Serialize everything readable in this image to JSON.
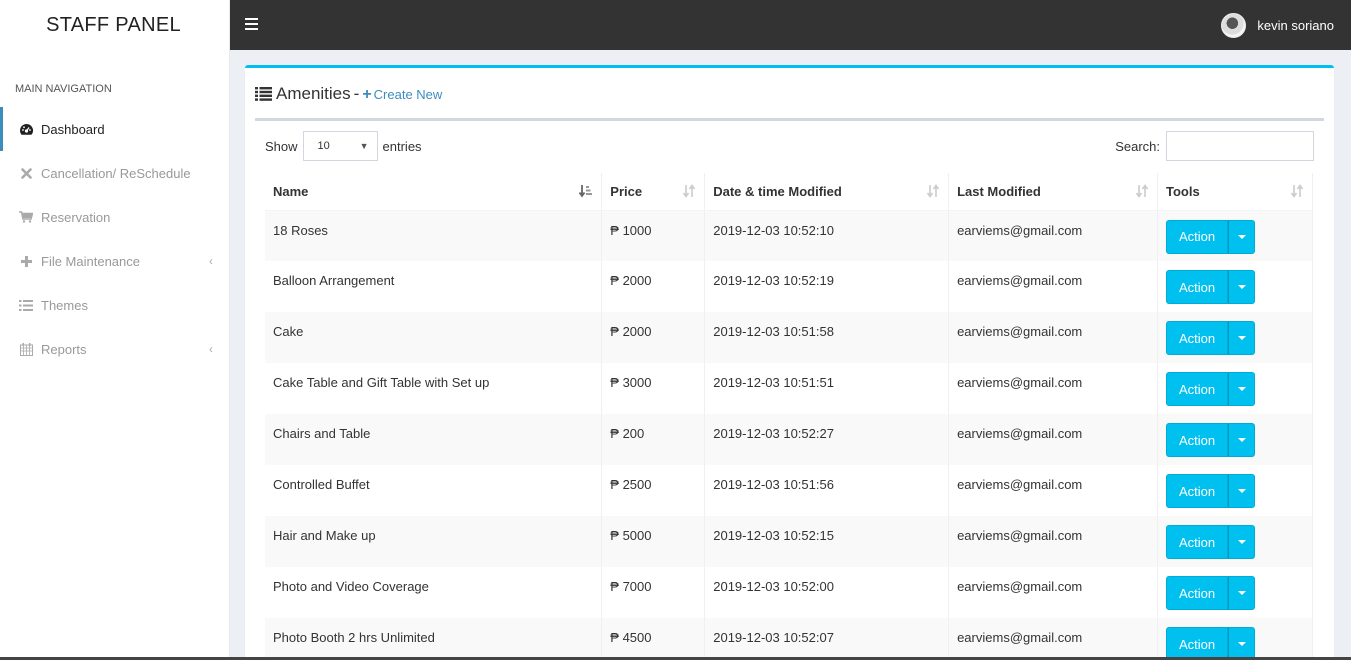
{
  "sidebar": {
    "brand": "STAFF PANEL",
    "nav_header": "MAIN NAVIGATION",
    "items": [
      {
        "label": "Dashboard",
        "icon": "dashboard-icon",
        "active": true,
        "has_submenu": false
      },
      {
        "label": "Cancellation/ ReSchedule",
        "icon": "close-icon",
        "active": false,
        "has_submenu": false
      },
      {
        "label": "Reservation",
        "icon": "cart-icon",
        "active": false,
        "has_submenu": false
      },
      {
        "label": "File Maintenance",
        "icon": "plus-icon",
        "active": false,
        "has_submenu": true
      },
      {
        "label": "Themes",
        "icon": "list-icon",
        "active": false,
        "has_submenu": false
      },
      {
        "label": "Reports",
        "icon": "calendar-icon",
        "active": false,
        "has_submenu": true
      }
    ]
  },
  "topbar": {
    "user_name": "kevin soriano"
  },
  "box": {
    "title": "Amenities",
    "separator": "-",
    "create_label": "Create New"
  },
  "controls": {
    "show_label": "Show",
    "entries_value": "10",
    "entries_label": "entries",
    "search_label": "Search:",
    "search_value": ""
  },
  "table": {
    "columns": [
      "Name",
      "Price",
      "Date & time Modified",
      "Last Modified",
      "Tools"
    ],
    "rows": [
      {
        "name": "18 Roses",
        "price": "₱ 1000",
        "date": "2019-12-03 10:52:10",
        "last": "earviems@gmail.com",
        "action": "Action"
      },
      {
        "name": "Balloon Arrangement",
        "price": "₱ 2000",
        "date": "2019-12-03 10:52:19",
        "last": "earviems@gmail.com",
        "action": "Action"
      },
      {
        "name": "Cake",
        "price": "₱ 2000",
        "date": "2019-12-03 10:51:58",
        "last": "earviems@gmail.com",
        "action": "Action"
      },
      {
        "name": "Cake Table and Gift Table with Set up",
        "price": "₱ 3000",
        "date": "2019-12-03 10:51:51",
        "last": "earviems@gmail.com",
        "action": "Action"
      },
      {
        "name": "Chairs and Table",
        "price": "₱ 200",
        "date": "2019-12-03 10:52:27",
        "last": "earviems@gmail.com",
        "action": "Action"
      },
      {
        "name": "Controlled Buffet",
        "price": "₱ 2500",
        "date": "2019-12-03 10:51:56",
        "last": "earviems@gmail.com",
        "action": "Action"
      },
      {
        "name": "Hair and Make up",
        "price": "₱ 5000",
        "date": "2019-12-03 10:52:15",
        "last": "earviems@gmail.com",
        "action": "Action"
      },
      {
        "name": "Photo and Video Coverage",
        "price": "₱ 7000",
        "date": "2019-12-03 10:52:00",
        "last": "earviems@gmail.com",
        "action": "Action"
      },
      {
        "name": "Photo Booth 2 hrs Unlimited",
        "price": "₱ 4500",
        "date": "2019-12-03 10:52:07",
        "last": "earviems@gmail.com",
        "action": "Action"
      }
    ]
  },
  "colors": {
    "accent": "#00c0ef",
    "topbar": "#333333",
    "link": "#3c8dbc"
  }
}
